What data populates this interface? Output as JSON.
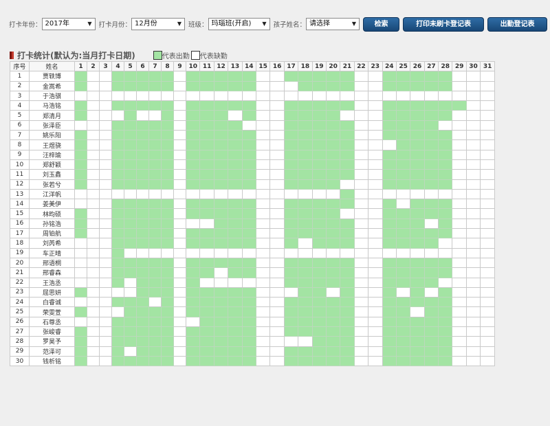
{
  "filters": {
    "year_label": "打卡年份：",
    "year_value": "2017年",
    "month_label": "打卡月份：",
    "month_value": "12月份",
    "class_label": "班级：",
    "class_value": "玛瑙班(开启)",
    "child_label": "孩子姓名：",
    "child_value": "请选择"
  },
  "buttons": {
    "search": "检索",
    "print_unswiped": "打印未刷卡登记表",
    "attendance_register": "出勤登记表"
  },
  "section": {
    "title": "打卡统计(默认为:当月打卡日期)",
    "legend_present": "代表出勤",
    "legend_absent": "代表缺勤",
    "present_color": "#a3e4a3",
    "absent_color": "#ffffff"
  },
  "table": {
    "col_index": "序号",
    "col_name": "姓名",
    "days": [
      "1",
      "2",
      "3",
      "4",
      "5",
      "6",
      "7",
      "8",
      "9",
      "10",
      "11",
      "12",
      "13",
      "14",
      "15",
      "16",
      "17",
      "18",
      "19",
      "20",
      "21",
      "22",
      "23",
      "24",
      "25",
      "26",
      "27",
      "28",
      "29",
      "30",
      "31"
    ],
    "rows": [
      {
        "no": "1",
        "name": "贾轶博",
        "att": "1001111101111100111110011111000"
      },
      {
        "no": "2",
        "name": "金嵩希",
        "att": "1001111101111100011110011111000"
      },
      {
        "no": "3",
        "name": "于浩骐",
        "att": "0000000000000000000000000000000"
      },
      {
        "no": "4",
        "name": "马浩铭",
        "att": "1001111101111100111110011111100"
      },
      {
        "no": "5",
        "name": "郑清月",
        "att": "1000100101110100111100011111000"
      },
      {
        "no": "6",
        "name": "张泽臣",
        "att": "0001111101111000111110011110000"
      },
      {
        "no": "7",
        "name": "姚乐阳",
        "att": "1001111101111100111110011111000"
      },
      {
        "no": "8",
        "name": "王煜骁",
        "att": "1001111101111100111110001111000"
      },
      {
        "no": "9",
        "name": "汪梓瑜",
        "att": "1001111101111100111110011111000"
      },
      {
        "no": "10",
        "name": "郑舒颖",
        "att": "1001111101111100111110011111000"
      },
      {
        "no": "11",
        "name": "刘玉鑫",
        "att": "1001111101111100111110011111000"
      },
      {
        "no": "12",
        "name": "张若兮",
        "att": "1001111101111100111100011111000"
      },
      {
        "no": "13",
        "name": "江洋帆",
        "att": "0000000000000000000010000000000"
      },
      {
        "no": "14",
        "name": "姜美伊",
        "att": "0001111101111100111110010111000"
      },
      {
        "no": "15",
        "name": "林昀硕",
        "att": "1001111101111100111100011111000"
      },
      {
        "no": "16",
        "name": "孙铭浩",
        "att": "1001111100011100111110011101000"
      },
      {
        "no": "17",
        "name": "周铂航",
        "att": "1001111101111100111110011111000"
      },
      {
        "no": "18",
        "name": "刘芮希",
        "att": "0001111101111100101110011110000"
      },
      {
        "no": "19",
        "name": "车正晴",
        "att": "0001000000000000000000000000000"
      },
      {
        "no": "20",
        "name": "邢语桐",
        "att": "0001111101111100111110011111000"
      },
      {
        "no": "21",
        "name": "邢睿森",
        "att": "0001111101101100111110011111000"
      },
      {
        "no": "22",
        "name": "王浩丞",
        "att": "0001011101000000111110011110000"
      },
      {
        "no": "23",
        "name": "屈思妍",
        "att": "1000011101111100011010010101000"
      },
      {
        "no": "24",
        "name": "白睿诚",
        "att": "0001110101111100111110011111000"
      },
      {
        "no": "25",
        "name": "荣雯萱",
        "att": "1000111101111100111110011011000"
      },
      {
        "no": "26",
        "name": "石尊丞",
        "att": "0001111100111100111110011111000"
      },
      {
        "no": "27",
        "name": "张峻睿",
        "att": "1001111101111100111110011111000"
      },
      {
        "no": "28",
        "name": "罗昊予",
        "att": "1001111101111100001110011111000"
      },
      {
        "no": "29",
        "name": "范泽可",
        "att": "1001011101111100111110011111000"
      },
      {
        "no": "30",
        "name": "钱析铭",
        "att": "1001111101111100111110011111000"
      }
    ]
  }
}
